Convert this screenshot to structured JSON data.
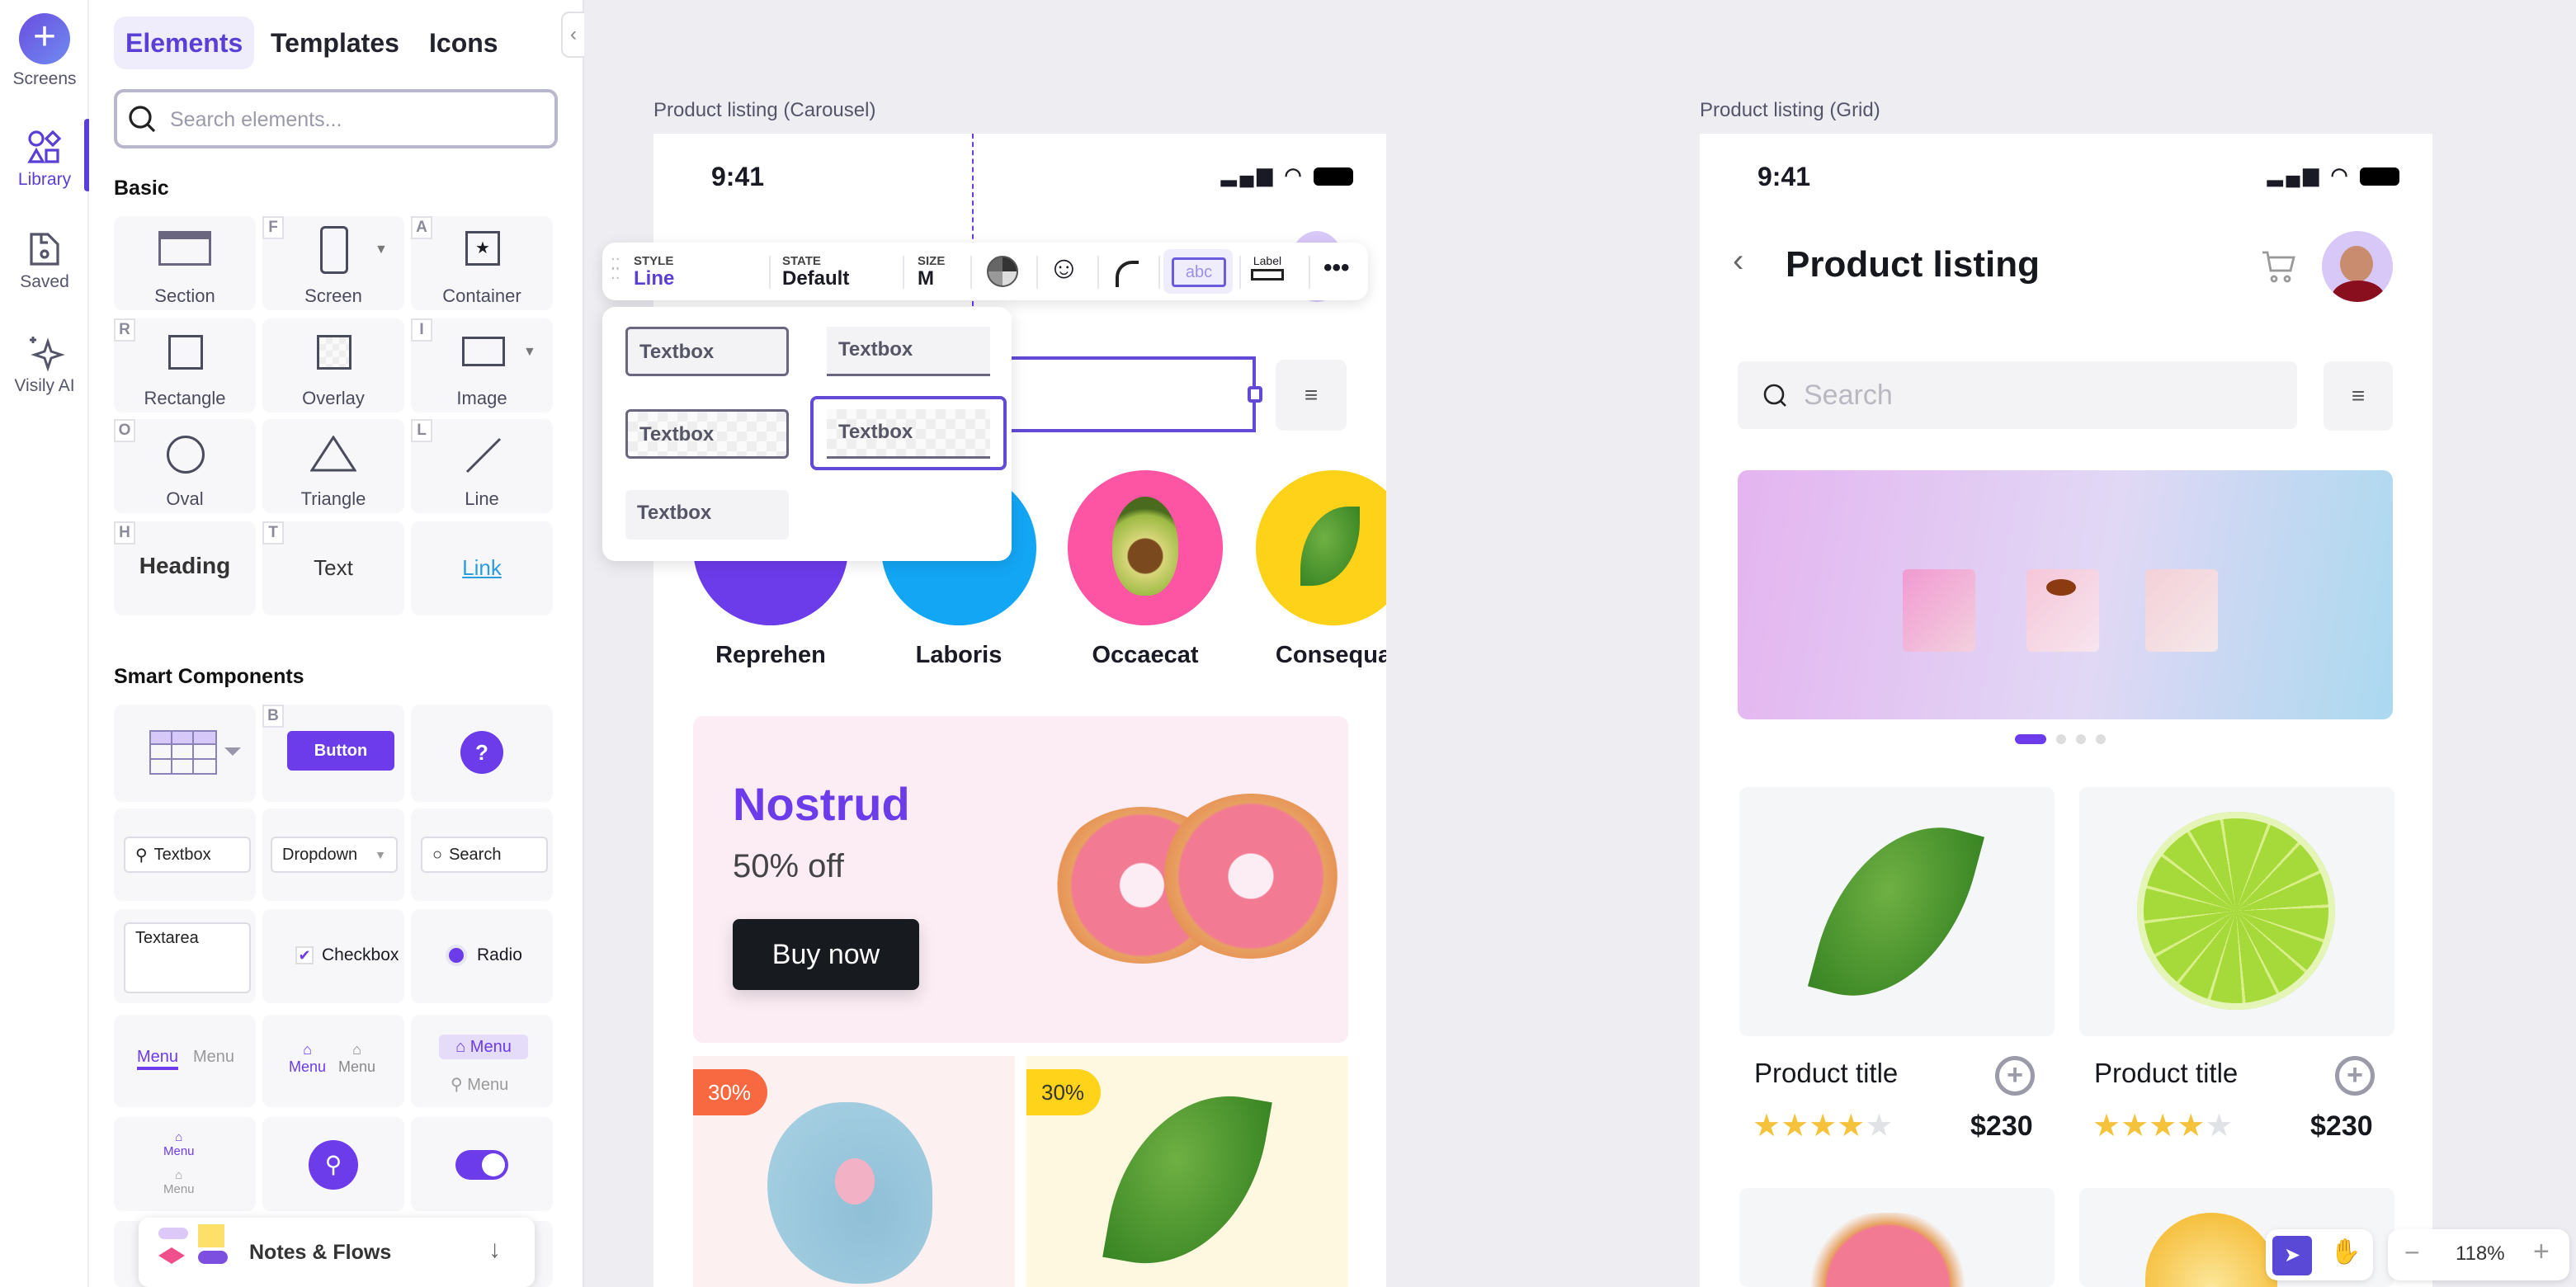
{
  "rail": {
    "items": [
      {
        "label": "Screens",
        "icon": "plus-icon"
      },
      {
        "label": "Library",
        "icon": "shapes-icon",
        "active": true
      },
      {
        "label": "Saved",
        "icon": "save-icon"
      },
      {
        "label": "Visily AI",
        "icon": "sparkle-icon"
      }
    ]
  },
  "panel": {
    "tabs": [
      "Elements",
      "Templates",
      "Icons"
    ],
    "active_tab": "Elements",
    "search_placeholder": "Search elements...",
    "basic_title": "Basic",
    "basic": [
      {
        "label": "Section",
        "key": ""
      },
      {
        "label": "Screen",
        "key": "F"
      },
      {
        "label": "Container",
        "key": "A"
      },
      {
        "label": "Rectangle",
        "key": "R"
      },
      {
        "label": "Overlay",
        "key": ""
      },
      {
        "label": "Image",
        "key": "I"
      },
      {
        "label": "Oval",
        "key": "O"
      },
      {
        "label": "Triangle",
        "key": ""
      },
      {
        "label": "Line",
        "key": "L"
      },
      {
        "label": "Heading",
        "key": "H"
      },
      {
        "label": "Text",
        "key": "T"
      },
      {
        "label": "Link",
        "key": ""
      }
    ],
    "smart_title": "Smart Components",
    "smart": {
      "button_key": "B",
      "button": "Button",
      "help": "?",
      "textbox": "Textbox",
      "dropdown": "Dropdown",
      "search": "Search",
      "textarea": "Textarea",
      "checkbox": "Checkbox",
      "radio": "Radio",
      "menu": "Menu"
    },
    "notes_flows": "Notes & Flows"
  },
  "carousel": {
    "label": "Product listing (Carousel)",
    "time": "9:41",
    "categories": [
      {
        "label": "Reprehen",
        "color": "#6c3bea"
      },
      {
        "label": "Laboris",
        "color": "#13a6f5"
      },
      {
        "label": "Occaecat",
        "color": "#fd55a3"
      },
      {
        "label": "Consequa",
        "color": "#ffd21a"
      }
    ],
    "promo": {
      "title": "Nostrud",
      "subtitle": "50% off",
      "button": "Buy now"
    },
    "badges": [
      "30%",
      "30%"
    ]
  },
  "toolbar": {
    "style_caption": "STYLE",
    "style_value": "Line",
    "state_caption": "STATE",
    "state_value": "Default",
    "size_caption": "SIZE",
    "size_value": "M",
    "label_icon_text": "Label",
    "textbox_icon_text": "abc"
  },
  "style_options": [
    "Textbox",
    "Textbox",
    "Textbox",
    "Textbox",
    "Textbox"
  ],
  "grid": {
    "label": "Product listing (Grid)",
    "time": "9:41",
    "title": "Product listing",
    "search_placeholder": "Search",
    "products": [
      {
        "title": "Product title",
        "price": "$230",
        "rating": 4
      },
      {
        "title": "Product title",
        "price": "$230",
        "rating": 4
      }
    ],
    "carousel_dots": 4,
    "active_dot": 0
  },
  "zoom": {
    "level": "118%"
  },
  "colors": {
    "accent": "#6c3bea",
    "star": "#f5c33b"
  }
}
